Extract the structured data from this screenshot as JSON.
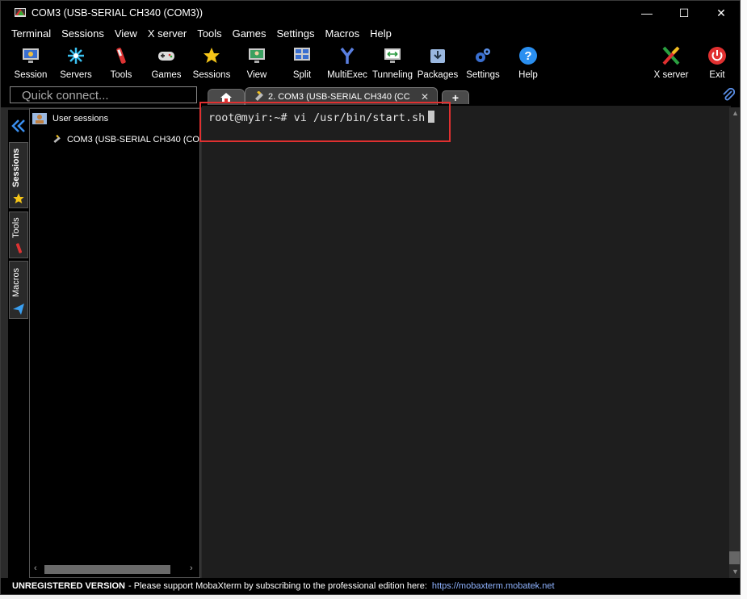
{
  "window": {
    "title": "COM3  (USB-SERIAL CH340 (COM3))",
    "controls": {
      "minimize": "—",
      "maximize": "☐",
      "close": "✕"
    }
  },
  "menu": [
    "Terminal",
    "Sessions",
    "View",
    "X server",
    "Tools",
    "Games",
    "Settings",
    "Macros",
    "Help"
  ],
  "toolbar": {
    "session": "Session",
    "servers": "Servers",
    "tools": "Tools",
    "games": "Games",
    "sessions": "Sessions",
    "view": "View",
    "split": "Split",
    "multiexec": "MultiExec",
    "tunneling": "Tunneling",
    "packages": "Packages",
    "settings": "Settings",
    "help": "Help",
    "xserver": "X server",
    "exit": "Exit"
  },
  "quick_connect": {
    "placeholder": "Quick connect..."
  },
  "tabs": {
    "active_label": "2. COM3  (USB-SERIAL CH340 (CC",
    "close": "✕",
    "add": "+"
  },
  "side_tabs": {
    "sessions": "Sessions",
    "tools": "Tools",
    "macros": "Macros"
  },
  "sessions_panel": {
    "group": "User sessions",
    "item": "COM3  (USB-SERIAL CH340 (CO"
  },
  "terminal": {
    "prompt_line": "root@myir:~# vi /usr/bin/start.sh"
  },
  "status": {
    "unregistered": "UNREGISTERED VERSION",
    "message": " -  Please support MobaXterm by subscribing to the professional edition here:",
    "link": "https://mobaxterm.mobatek.net"
  },
  "colors": {
    "highlight": "#e03030",
    "terminal_bg": "#1e1e1e",
    "link": "#8fb3ff"
  }
}
